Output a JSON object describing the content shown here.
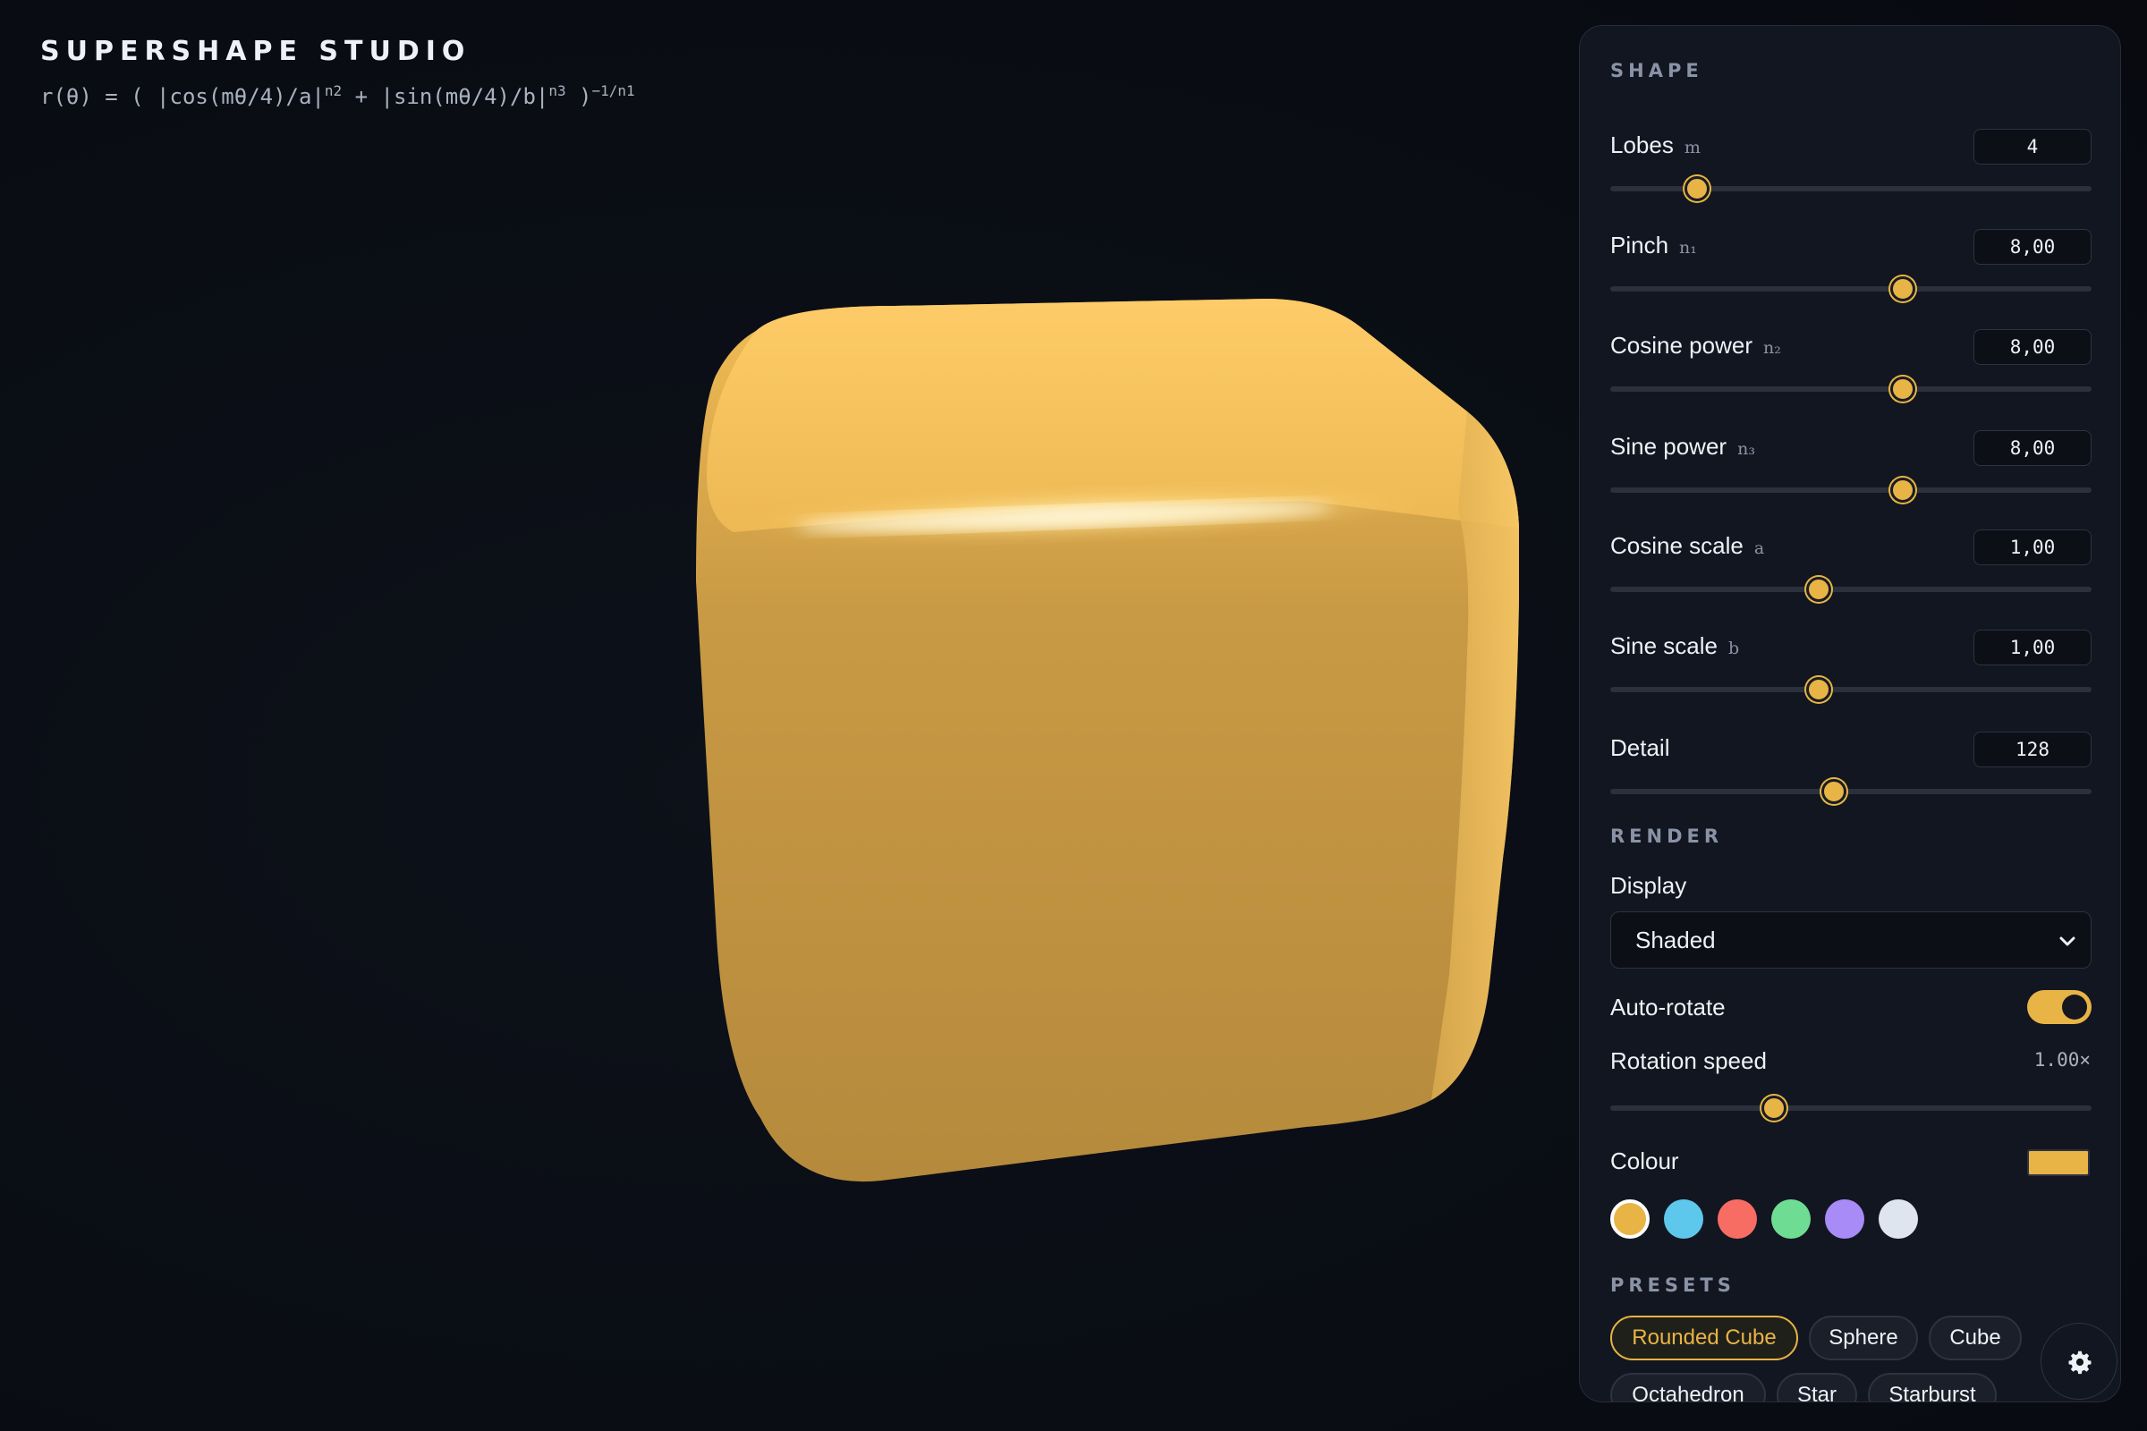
{
  "header": {
    "title": "SUPERSHAPE STUDIO",
    "formula_main": "r(θ) = ( |cos(mθ/4)/a|",
    "formula_exp1": "n2",
    "formula_mid": " + |sin(mθ/4)/b|",
    "formula_exp2": "n3",
    "formula_close": " )",
    "formula_exp3": "−1/n1"
  },
  "panel": {
    "shape_section": "SHAPE",
    "params": [
      {
        "label": "Lobes",
        "symbol": "m",
        "value": "4",
        "level": 0.18
      },
      {
        "label": "Pinch",
        "symbol": "n₁",
        "value": "8,00",
        "level": 0.607
      },
      {
        "label": "Cosine power",
        "symbol": "n₂",
        "value": "8,00",
        "level": 0.607
      },
      {
        "label": "Sine power",
        "symbol": "n₃",
        "value": "8,00",
        "level": 0.607
      },
      {
        "label": "Cosine scale",
        "symbol": "a",
        "value": "1,00",
        "level": 0.433
      },
      {
        "label": "Sine scale",
        "symbol": "b",
        "value": "1,00",
        "level": 0.433
      },
      {
        "label": "Detail",
        "symbol": "",
        "value": "128",
        "level": 0.465
      }
    ],
    "render_section": "RENDER",
    "display_label": "Display",
    "display_value": "Shaded",
    "autorotate_label": "Auto-rotate",
    "autorotate_on": true,
    "speed_label": "Rotation speed",
    "speed_value": "1.00×",
    "speed_level": 0.34,
    "colour_label": "Colour",
    "colour_current": "#e8b445",
    "swatches": [
      "#e8b445",
      "#5ec8ec",
      "#f76d63",
      "#6fdc94",
      "#a88bf7",
      "#dfe5ef"
    ],
    "presets_section": "PRESETS",
    "presets": [
      "Rounded Cube",
      "Sphere",
      "Cube",
      "Octahedron",
      "Star",
      "Starburst"
    ],
    "active_preset": "Rounded Cube",
    "settings_icon": "gear-icon"
  }
}
